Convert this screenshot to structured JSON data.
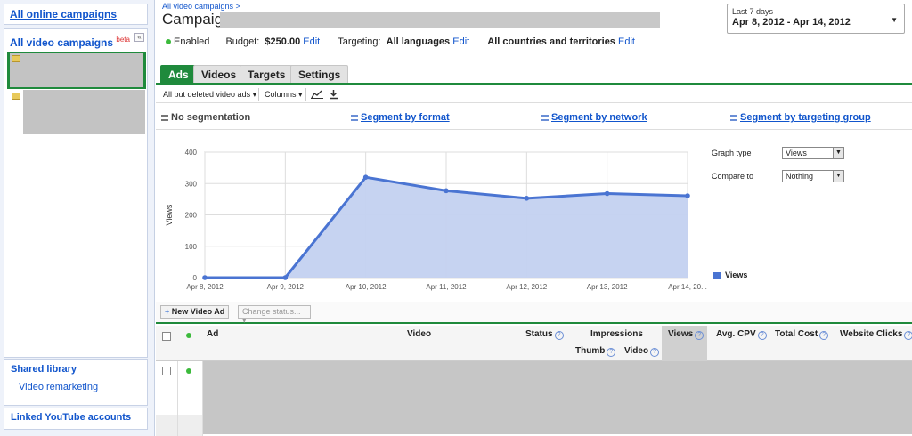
{
  "sidebar": {
    "all_online": "All online campaigns",
    "all_video": "All video campaigns",
    "beta": "beta",
    "collapse": "«",
    "shared_library": "Shared library",
    "video_remarketing": "Video remarketing",
    "linked_youtube": "Linked YouTube accounts"
  },
  "header": {
    "breadcrumb": "All video campaigns >",
    "title_prefix": "Campaign",
    "status": "Enabled",
    "budget_label": "Budget:",
    "budget_value": "$250.00",
    "edit": "Edit",
    "targeting_label": "Targeting:",
    "targeting_value": "All languages",
    "countries": "All countries and territories"
  },
  "date_range": {
    "preset": "Last 7 days",
    "range": "Apr 8, 2012 - Apr 14, 2012",
    "arrow": "▼"
  },
  "tabs": [
    {
      "label": "Ads",
      "active": true
    },
    {
      "label": "Videos",
      "active": false
    },
    {
      "label": "Targets",
      "active": false
    },
    {
      "label": "Settings",
      "active": false
    }
  ],
  "toolbar": {
    "filter": "All but deleted video ads",
    "columns": "Columns",
    "caret": "▾"
  },
  "segments": {
    "none": "No segmentation",
    "format": "Segment by format",
    "network": "Segment by network",
    "group": "Segment by targeting group"
  },
  "graph_controls": {
    "graph_type_label": "Graph type",
    "graph_type_value": "Views",
    "compare_label": "Compare to",
    "compare_value": "Nothing"
  },
  "chart_data": {
    "type": "area",
    "x": [
      "Apr 8, 2012",
      "Apr 9, 2012",
      "Apr 10, 2012",
      "Apr 11, 2012",
      "Apr 12, 2012",
      "Apr 13, 2012",
      "Apr 14, 20..."
    ],
    "series": [
      {
        "name": "Views",
        "values": [
          0,
          0,
          320,
          277,
          253,
          268,
          261
        ],
        "color": "#4a74d2"
      }
    ],
    "ylabel": "Views",
    "ylim": [
      0,
      400
    ],
    "yticks": [
      0,
      100,
      200,
      300,
      400
    ],
    "grid": true,
    "legend": "right"
  },
  "actions": {
    "new_video_ad": "New Video Ad",
    "change_status": "Change status...",
    "plus": "+"
  },
  "table": {
    "col_ad": "Ad",
    "col_video": "Video",
    "col_status": "Status",
    "col_impressions": "Impressions",
    "col_thumb": "Thumb",
    "col_video_sub": "Video",
    "col_views": "Views",
    "col_avg_cpv": "Avg. CPV",
    "col_total_cost": "Total Cost",
    "col_website_clicks": "Website Clicks",
    "help": "?"
  }
}
